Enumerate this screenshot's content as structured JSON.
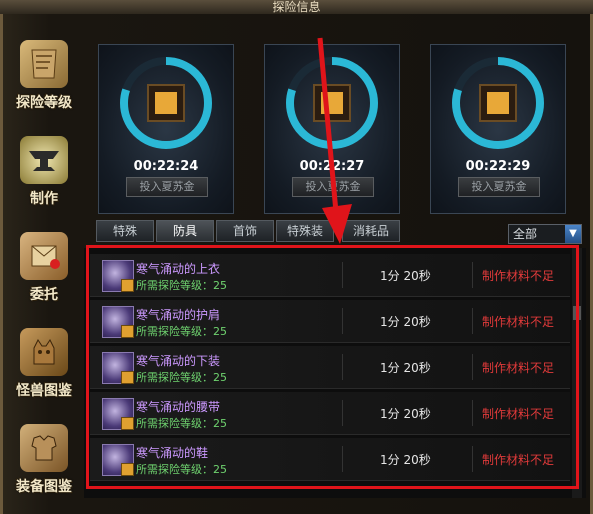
{
  "window": {
    "title": "探险信息"
  },
  "sidebar": {
    "items": [
      {
        "label": "探险等级",
        "icon": "scroll-icon"
      },
      {
        "label": "制作",
        "icon": "anvil-icon"
      },
      {
        "label": "委托",
        "icon": "letter-icon"
      },
      {
        "label": "怪兽图鉴",
        "icon": "monster-icon"
      },
      {
        "label": "装备图鉴",
        "icon": "armor-icon"
      }
    ]
  },
  "timers": [
    {
      "time": "00:22:24",
      "button": "投入夏苏金",
      "progress": 0.8
    },
    {
      "time": "00:22:27",
      "button": "投入夏苏金",
      "progress": 0.8
    },
    {
      "time": "00:22:29",
      "button": "投入夏苏金",
      "progress": 0.8
    }
  ],
  "tabs": [
    {
      "label": "特殊"
    },
    {
      "label": "防具"
    },
    {
      "label": "首饰"
    },
    {
      "label": "特殊装"
    },
    {
      "label": "消耗品"
    }
  ],
  "active_tab": "防具",
  "filter": {
    "value": "全部"
  },
  "items": [
    {
      "name": "寒气涌动的上衣",
      "req": "所需探险等级：25",
      "duration": "1分 20秒",
      "status": "制作材料不足"
    },
    {
      "name": "寒气涌动的护肩",
      "req": "所需探险等级：25",
      "duration": "1分 20秒",
      "status": "制作材料不足"
    },
    {
      "name": "寒气涌动的下装",
      "req": "所需探险等级：25",
      "duration": "1分 20秒",
      "status": "制作材料不足"
    },
    {
      "name": "寒气涌动的腰带",
      "req": "所需探险等级：25",
      "duration": "1分 20秒",
      "status": "制作材料不足"
    },
    {
      "name": "寒气涌动的鞋",
      "req": "所需探险等级：25",
      "duration": "1分 20秒",
      "status": "制作材料不足"
    }
  ],
  "colors": {
    "ring": "#2bb8d6",
    "status_red": "#e03a3a",
    "item_purple": "#cc99ff",
    "req_green": "#6fd36f",
    "highlight": "#e0141a"
  }
}
